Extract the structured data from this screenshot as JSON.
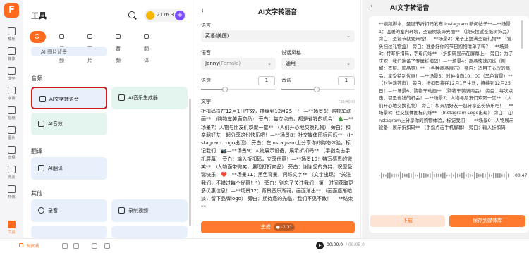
{
  "rail": {
    "logo": "F",
    "items": [
      {
        "label": "模板"
      },
      {
        "label": "媒体"
      },
      {
        "label": "文字"
      },
      {
        "label": "字幕"
      },
      {
        "label": "贴纸"
      },
      {
        "label": "图片"
      },
      {
        "label": "音频"
      },
      {
        "label": "元素"
      },
      {
        "label": "特效"
      },
      {
        "label": "工具"
      }
    ]
  },
  "tools": {
    "title": "工具",
    "coins": "2176.3",
    "plus": "+",
    "tabs": [
      {
        "label": "热门"
      },
      {
        "label": "视频"
      },
      {
        "label": "图片"
      },
      {
        "label": "音频"
      },
      {
        "label": "翻译"
      }
    ],
    "partial_card": "AI 图片背景",
    "audio_section": "音频",
    "audio_cards": [
      {
        "label": "AI文字转语音"
      },
      {
        "label": "AI音乐生成器"
      },
      {
        "label": "AI音效"
      }
    ],
    "translate_section": "翻译",
    "translate_cards": [
      {
        "label": "AI翻译"
      }
    ],
    "other_section": "其他",
    "other_cards": [
      {
        "label": "录音"
      },
      {
        "label": "录制视频"
      }
    ]
  },
  "editor": {
    "back": "‹",
    "title": "AI文字转语音",
    "language_label": "语言",
    "language_value": "英语(美国)",
    "voice_label": "语音",
    "voice_name": "Jenny",
    "voice_gender": "(Female)",
    "style_label": "说话风格",
    "style_value": "通用",
    "speed_label": "语速",
    "speed_value": "1",
    "pitch_label": "音调",
    "pitch_value": "1",
    "text_label": "文字",
    "counter": "738/4000",
    "text": "折扣码将在12月1日生效，持续到12月25日！ —**场景6：购物车动画** （购物车装满商品） 旁白：每次点击，都是省钱的机会！🎄—**场景7：人物与朋友们欢聚一堂** （人们开心地交换礼物） 旁白：和亲朋好友一起分享这份快乐吧！—**场景8：社交媒体图标闪烁** （Instagram Logo出现） 旁白：在Instagram上分享你的购物体验，标记我们！📷—**场景9：人物展示设备，展示折扣码** （手指点击手机屏幕） 旁白：输入折扣码，立享优惠！—**场景10：特写感恩的微笑** （人物面带微笑，展现打折商品） 旁白：谢谢您的支持，祝您圣诞快乐！❤️—**场景11：黑色背景，闪烁文字** （文字出现：“关注我们，不错过每个优惠！”） 旁白：别忘了关注我们，第一时间获取更多优惠信息！—**场景12：背景音乐渐弱，画面渐出** （画面逐渐暗淡，留下品牌logo） 旁白：期待您的光临，我们不见不散！ —**结束**",
    "generate_label": "生成",
    "generate_cost": "-2.31"
  },
  "preview": {
    "back": "‹",
    "title": "AI文字转语音",
    "text": "**视频脚本：圣诞节折扣码发布 Instagram 新闻帖子**—**场景1：温暖的室内环境，圣诞树装饰亮丽** （镜头拉近圣诞树饰品） 旁白：圣诞节就要来啦！—**场景2：桌子上摆满圣诞礼物** （镜头扫过礼物盒） 旁白：准备好你的节日购物清单了吗？—**场景3：特写折扣码，字母闪烁** （折扣码显示在屏幕上） 旁白：为了庆祝，我们准备了专属折扣码！—**场景4：商品快速闪烁（例如：衣服、饰品等）** （各种商品展示） 旁白：适用于心仪的商品，享受特别优惠！—**场景5：时钟指向10：00（黑色背景）** （时钟滴答声） 旁白：折扣码将在12月1日生效，持续到12月25日！—**场景6：购物车动画** （购物车装满商品） 旁白：每次点击，都是省钱的机会！—**场景7：人物与朋友们欢聚一堂** （人们开心地交换礼物） 旁白：和亲朋好友一起分享这份快乐吧！—**场景8：社交媒体图标闪烁** （Instagram Logo出现） 旁白：在Instagram上分享你的购物体验，标记我们！—**场景9：人物展示设备，展示折扣码** （手指点击手机屏幕） 旁白：输入折扣码",
    "duration": "00:47",
    "download_label": "下载",
    "save_label": "保存到媒体库"
  },
  "bottombar": {
    "timeline_label": "时间线",
    "current_time": "00:00.0",
    "total_time": "/ 00:05.0"
  },
  "colors": {
    "accent": "#ff6a1f",
    "selected_border": "#d11a1a",
    "card_blue": "#e8f1fb",
    "card_green": "#e4f5ef"
  }
}
